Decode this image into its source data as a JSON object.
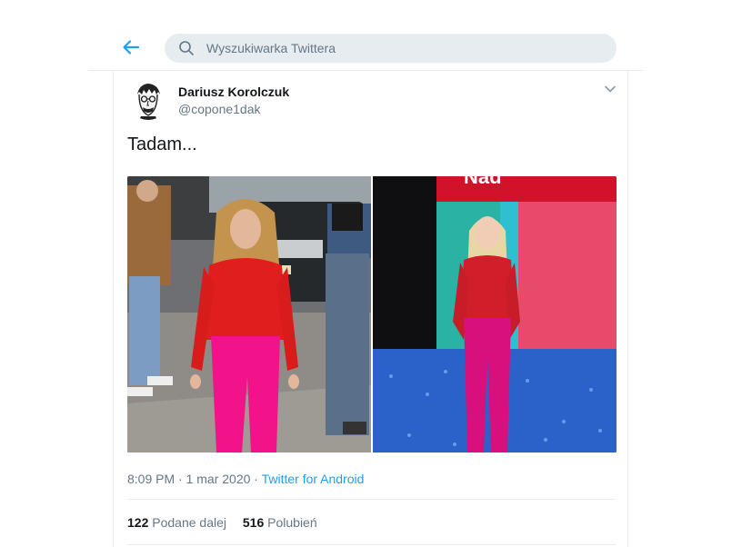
{
  "header": {
    "back_icon": "arrow-left-icon",
    "search": {
      "placeholder": "Wyszukiwarka Twittera",
      "value": "",
      "icon": "search-icon"
    }
  },
  "tweet": {
    "author": {
      "display_name": "Dariusz Korolczuk",
      "handle": "@copone1dak"
    },
    "menu_icon": "chevron-down-icon",
    "text": "Tadam...",
    "photos": [
      {
        "icon": "photo-woman-red-blouse-pink-pants-street"
      },
      {
        "icon": "photo-woman-red-blouse-pink-pants-stage"
      }
    ],
    "time": "8:09 PM · 1 mar 2020",
    "separator": " · ",
    "source": "Twitter for Android",
    "retweets": {
      "count": "122",
      "label": "Podane dalej"
    },
    "likes": {
      "count": "516",
      "label": "Polubień"
    }
  },
  "colors": {
    "accent": "#1da1f2",
    "muted": "#657786",
    "border": "#e6ecf0",
    "search_bg": "#e6ecf0"
  }
}
